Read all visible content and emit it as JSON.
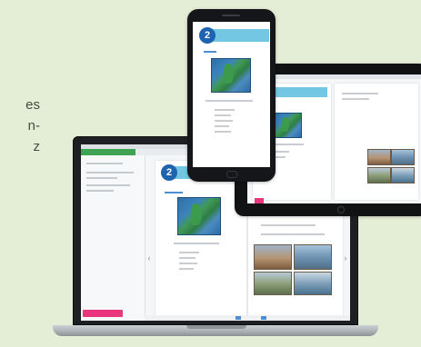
{
  "side_text": {
    "lines": [
      "es",
      "n-",
      "z"
    ]
  },
  "lesson": {
    "number": "2"
  },
  "colors": {
    "background": "#e4edd5",
    "accent_blue": "#1e63b0",
    "banner_cyan": "#74c7e2",
    "accent_green": "#3fa353",
    "accent_pink": "#e8357b"
  },
  "devices": {
    "phone": "smartphone-icon",
    "tablet": "tablet-icon",
    "laptop": "laptop-icon"
  }
}
